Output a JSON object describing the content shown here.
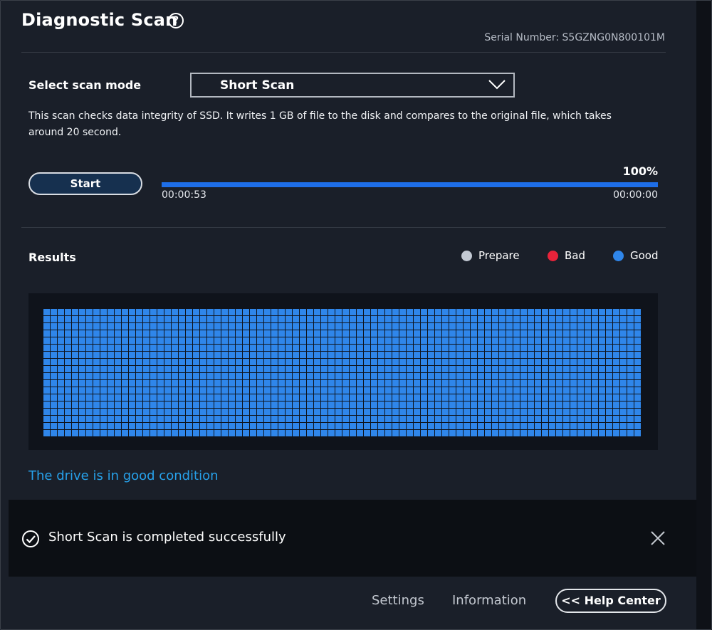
{
  "header": {
    "title": "Diagnostic Scan",
    "help_icon": "question-circle-icon",
    "serial_number": "Serial Number: S5GZNG0N800101M"
  },
  "scan_mode": {
    "label": "Select scan mode",
    "selected": "Short Scan",
    "description": "This scan checks data integrity of SSD. It writes 1 GB of file to the disk and compares to the original file, which takes around 20 second."
  },
  "progress": {
    "start_label": "Start",
    "percent": 100,
    "percent_text": "100%",
    "elapsed": "00:00:53",
    "remaining": "00:00:00"
  },
  "results": {
    "label": "Results",
    "legend": [
      {
        "label": "Prepare",
        "color": "#c3c9d3"
      },
      {
        "label": "Bad",
        "color": "#e8233a"
      },
      {
        "label": "Good",
        "color": "#2f86ea"
      }
    ],
    "status_text": "The drive is in good condition"
  },
  "toast": {
    "icon": "check-circle-icon",
    "message": "Short Scan is completed successfully",
    "close_icon": "close-icon"
  },
  "footer": {
    "settings": "Settings",
    "information": "Information",
    "help_center": "<< Help Center"
  },
  "colors": {
    "background": "#1a1f29",
    "accent": "#1e6ee8",
    "good": "#2f86ea",
    "status_text": "#27a1ea"
  }
}
